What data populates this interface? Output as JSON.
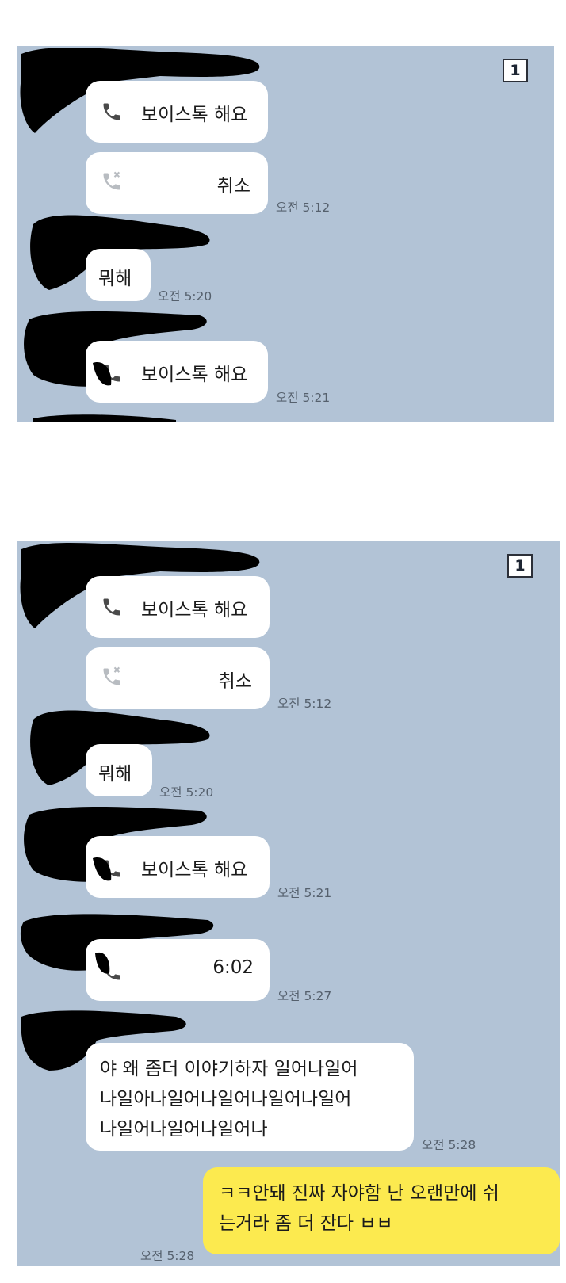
{
  "panels": [
    {
      "badge": "1",
      "messages": [
        {
          "kind": "call",
          "icon": "phone-icon",
          "label": "보이스톡 해요",
          "time": ""
        },
        {
          "kind": "call",
          "icon": "missed-call-icon",
          "label": "취소",
          "time": "오전 5:12"
        },
        {
          "kind": "text",
          "label": "뭐해",
          "time": "오전 5:20"
        },
        {
          "kind": "call",
          "icon": "phone-icon",
          "label": "보이스톡 해요",
          "time": "오전 5:21"
        }
      ]
    },
    {
      "badge": "1",
      "messages": [
        {
          "kind": "call",
          "icon": "phone-icon",
          "label": "보이스톡 해요",
          "time": ""
        },
        {
          "kind": "call",
          "icon": "missed-call-icon",
          "label": "취소",
          "time": "오전 5:12"
        },
        {
          "kind": "text",
          "label": "뭐해",
          "time": "오전 5:20"
        },
        {
          "kind": "call",
          "icon": "phone-icon",
          "label": "보이스톡 해요",
          "time": "오전 5:21"
        },
        {
          "kind": "call",
          "icon": "phone-icon",
          "label": "6:02",
          "time": "오전 5:27"
        },
        {
          "kind": "text",
          "label": "야 왜 좀더 이야기하자 일어나일어\n나일아나일어나일어나일어나일어\n나일어나일어나일어나",
          "time": "오전 5:28"
        },
        {
          "kind": "mine",
          "label": "ㅋㅋ안돼 진짜 자야함  난 오랜만에 쉬\n는거라 좀 더 잔다 ㅂㅂ",
          "time": "오전 5:28"
        }
      ]
    }
  ],
  "colors": {
    "chat_background": "#b2c3d6",
    "incoming_bubble": "#ffffff",
    "outgoing_bubble": "#fcea4f",
    "redaction": "#000000"
  }
}
